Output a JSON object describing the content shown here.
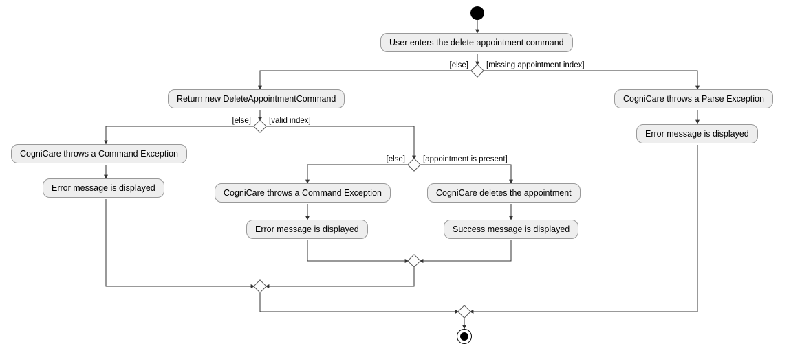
{
  "nodes": {
    "start_action": "User enters the delete appointment command",
    "branch1_else": "[else]",
    "branch1_missing": "[missing appointment index]",
    "return_cmd": "Return new DeleteAppointmentCommand",
    "parse_exception": "CogniCare throws a Parse Exception",
    "parse_error_msg": "Error message is displayed",
    "branch2_else": "[else]",
    "branch2_valid": "[valid index]",
    "cmd_exception_left": "CogniCare throws a Command Exception",
    "cmd_exception_left_msg": "Error message is displayed",
    "branch3_else": "[else]",
    "branch3_present": "[appointment is present]",
    "cmd_exception_mid": "CogniCare throws a Command Exception",
    "cmd_exception_mid_msg": "Error message is displayed",
    "delete_appt": "CogniCare deletes the appointment",
    "success_msg": "Success message is displayed"
  }
}
